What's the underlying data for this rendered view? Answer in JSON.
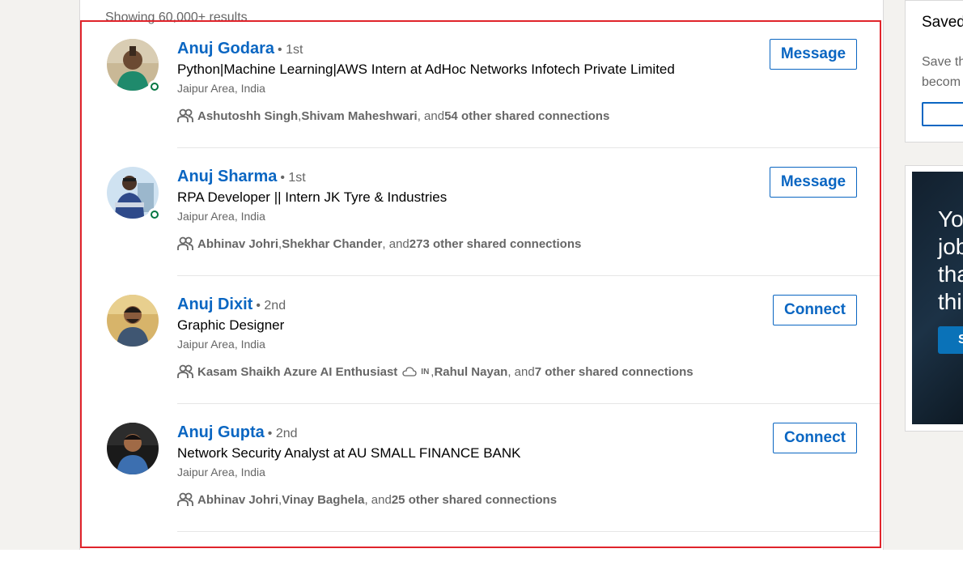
{
  "results_count": "Showing 60,000+ results",
  "results": [
    {
      "name": "Anuj Godara",
      "degree": "• 1st",
      "headline": "Python|Machine Learning|AWS Intern at AdHoc Networks Infotech Private Limited",
      "location": "Jaipur Area, India",
      "shared_a": "Ashutoshh Singh",
      "shared_sep": ", ",
      "shared_b": "Shivam Maheshwari",
      "shared_and": ", and ",
      "shared_count": "54 other shared connections",
      "action": "Message",
      "online": true
    },
    {
      "name": "Anuj Sharma",
      "degree": "• 1st",
      "headline": "RPA Developer || Intern JK Tyre & Industries",
      "location": "Jaipur Area, India",
      "shared_a": "Abhinav Johri",
      "shared_sep": ", ",
      "shared_b": "Shekhar Chander",
      "shared_and": ", and ",
      "shared_count": "273 other shared connections",
      "action": "Message",
      "online": true
    },
    {
      "name": "Anuj Dixit",
      "degree": "• 2nd",
      "headline": "Graphic Designer",
      "location": "Jaipur Area, India",
      "shared_a": "Kasam Shaikh Azure AI Enthusiast",
      "shared_in": "IN",
      "shared_sep": ", ",
      "shared_b": "Rahul Nayan",
      "shared_and": ", and ",
      "shared_count": "7 other shared connections",
      "action": "Connect",
      "online": false
    },
    {
      "name": "Anuj Gupta",
      "degree": "• 2nd",
      "headline": "Network Security Analyst at AU SMALL FINANCE BANK",
      "location": "Jaipur Area, India",
      "shared_a": "Abhinav Johri",
      "shared_sep": ", ",
      "shared_b": "Vinay Baghela",
      "shared_and": ", and ",
      "shared_count": "25 other shared connections",
      "action": "Connect",
      "online": false
    }
  ],
  "saved_search": {
    "title": "Saved",
    "text": "Save th\nbecom"
  },
  "ad": {
    "text": "Yo\njob\ntha\nthi",
    "button": "S"
  },
  "colors": {
    "link": "#0a66c2",
    "highlight": "#e0242b",
    "online": "#057642"
  }
}
